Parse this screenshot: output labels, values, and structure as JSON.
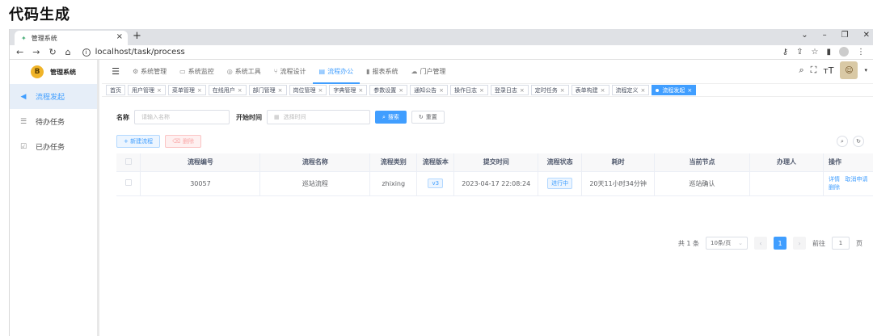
{
  "heading": "代码生成",
  "browser": {
    "tab_title": "管理系统",
    "tab_close": "×",
    "new_tab": "+",
    "url": "localhost/task/process",
    "win_min": "⌄",
    "win_minimize": "–",
    "win_restore": "❐",
    "win_close": "✕"
  },
  "sidebar": {
    "brand": "管理系统",
    "brand_mark": "B",
    "items": [
      {
        "label": "流程发起",
        "icon": "send-icon"
      },
      {
        "label": "待办任务",
        "icon": "tasks-icon"
      },
      {
        "label": "已办任务",
        "icon": "done-icon"
      }
    ]
  },
  "topnav": {
    "menu": [
      {
        "label": "系统管理"
      },
      {
        "label": "系统监控"
      },
      {
        "label": "系统工具"
      },
      {
        "label": "流程设计"
      },
      {
        "label": "流程办公"
      },
      {
        "label": "报表系统"
      },
      {
        "label": "门户管理"
      }
    ]
  },
  "tags": [
    "首页",
    "用户管理",
    "菜单管理",
    "在线用户",
    "部门管理",
    "岗位管理",
    "字典管理",
    "参数设置",
    "通知公告",
    "操作日志",
    "登录日志",
    "定时任务",
    "表单构建",
    "流程定义",
    "流程发起"
  ],
  "search": {
    "name_label": "名称",
    "name_placeholder": "请输入名称",
    "time_label": "开始时间",
    "time_placeholder": "选择时间",
    "search_btn": "搜索",
    "reset_btn": "重置"
  },
  "actions": {
    "add_btn": "+ 新建流程",
    "delete_btn": "删除"
  },
  "table": {
    "columns": [
      "流程编号",
      "流程名称",
      "流程类别",
      "流程版本",
      "提交时间",
      "流程状态",
      "耗时",
      "当前节点",
      "办理人",
      "操作"
    ],
    "rows": [
      {
        "id": "30057",
        "name": "巡站流程",
        "category": "zhixing",
        "version": "v3",
        "time": "2023-04-17 22:08:24",
        "status": "进行中",
        "duration": "20天11小时34分钟",
        "node": "巡站确认",
        "handler": "",
        "ops": [
          "详情",
          "取消申请",
          "删除"
        ]
      }
    ]
  },
  "pager": {
    "total": "共 1 条",
    "size": "10条/页",
    "page": "1",
    "goto_label": "前往",
    "goto_value": "1",
    "goto_unit": "页"
  }
}
